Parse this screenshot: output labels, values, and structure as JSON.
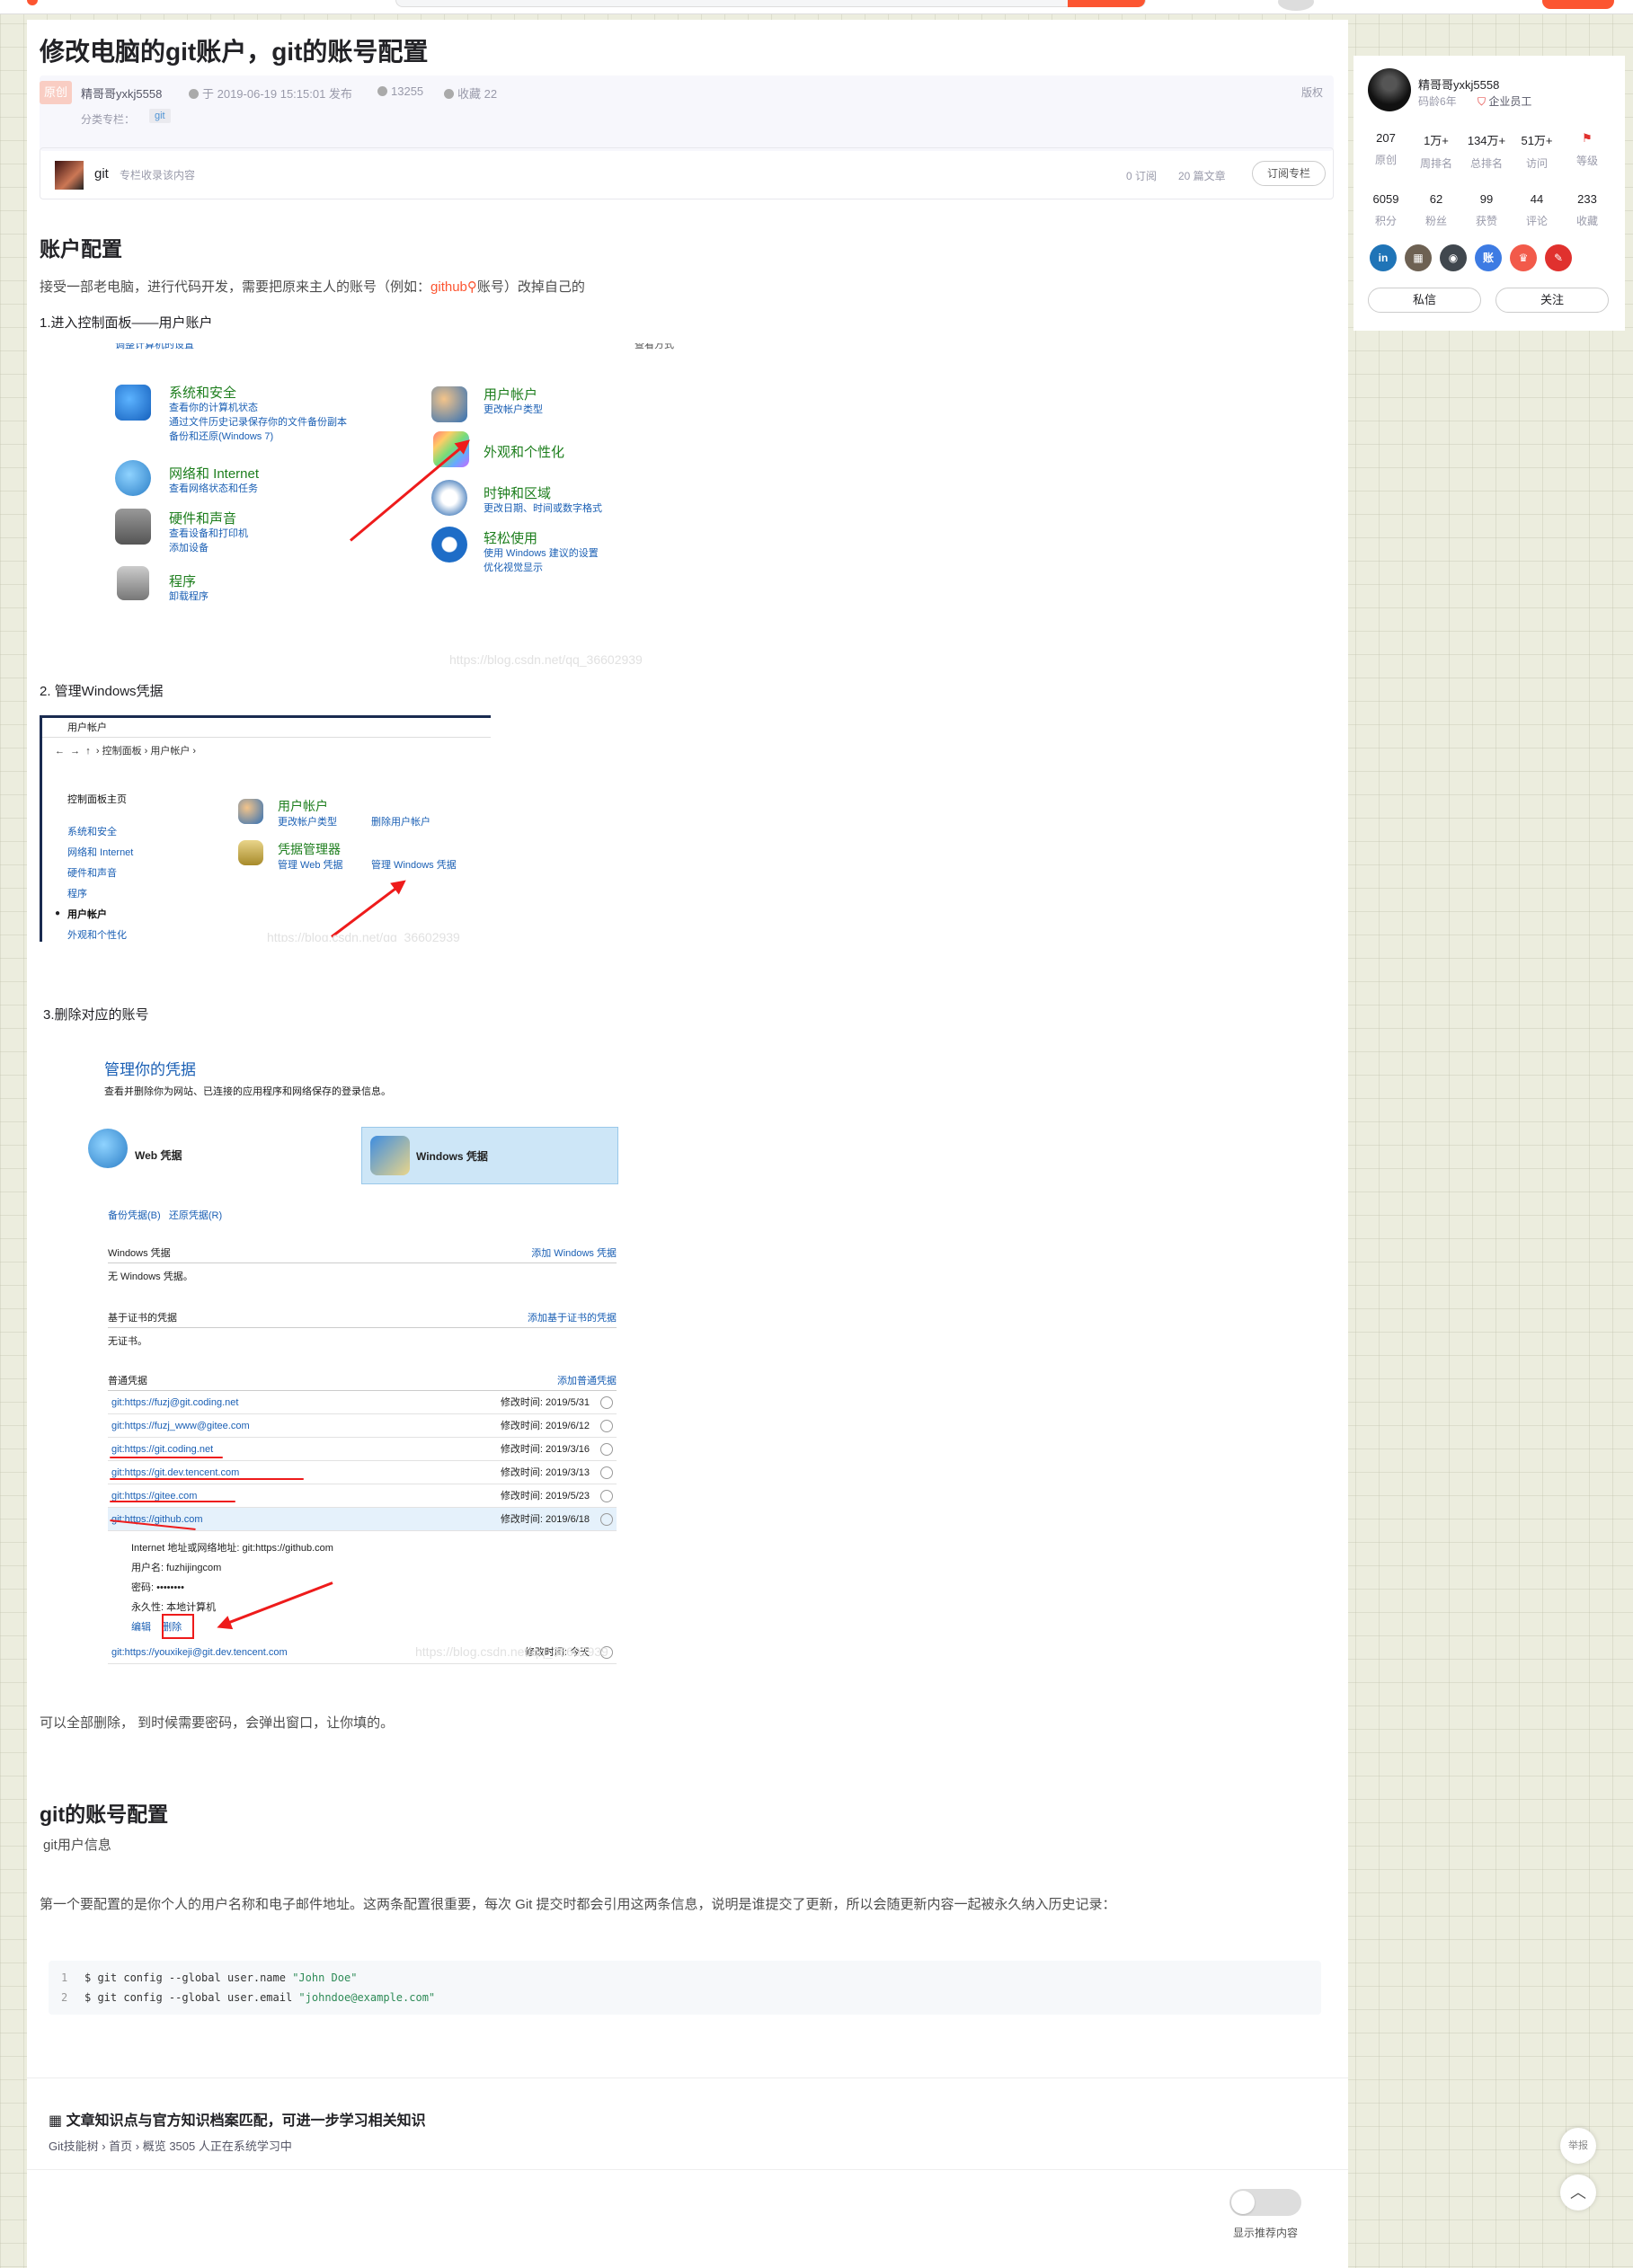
{
  "article": {
    "title": "修改电脑的git账户，git的账号配置",
    "badge": "原创",
    "author": "精哥哥yxkj5558",
    "date": "于 2019-06-19 15:15:01 发布",
    "views": "13255",
    "collect": "收藏 22",
    "copyright": "版权",
    "category_label": "分类专栏：",
    "category_tag": "git"
  },
  "column": {
    "name": "git",
    "desc": "专栏收录该内容",
    "subs": "0 订阅",
    "articles": "20 篇文章",
    "subscribe_btn": "订阅专栏"
  },
  "section1": {
    "heading": "账户配置",
    "intro_before": "接受一部老电脑，进行代码开发，需要把原来主人的账号（例如：",
    "intro_link": "github",
    "intro_after": "账号）改掉自己的",
    "step1": "1.进入控制面板——用户账户",
    "step2": "2. 管理Windows凭据",
    "step3": "3.删除对应的账号",
    "after_shots": "可以全部删除， 到时候需要密码，会弹出窗口，让你填的。"
  },
  "shot1": {
    "top_left": "调整计算机的设置",
    "top_right": "查看方式",
    "groups": [
      {
        "title": "系统和安全",
        "subs": [
          "查看你的计算机状态",
          "通过文件历史记录保存你的文件备份副本",
          "备份和还原(Windows 7)"
        ]
      },
      {
        "title": "网络和 Internet",
        "subs": [
          "查看网络状态和任务"
        ]
      },
      {
        "title": "硬件和声音",
        "subs": [
          "查看设备和打印机",
          "添加设备"
        ]
      },
      {
        "title": "程序",
        "subs": [
          "卸载程序"
        ]
      },
      {
        "title": "用户帐户",
        "subs": [
          "更改帐户类型"
        ]
      },
      {
        "title": "外观和个性化",
        "subs": []
      },
      {
        "title": "时钟和区域",
        "subs": [
          "更改日期、时间或数字格式"
        ]
      },
      {
        "title": "轻松使用",
        "subs": [
          "使用 Windows 建议的设置",
          "优化视觉显示"
        ]
      }
    ],
    "watermark": "https://blog.csdn.net/qq_36602939"
  },
  "shot2": {
    "window_title": "用户帐户",
    "breadcrumb": "›  控制面板  ›  用户帐户  ›",
    "side": [
      "控制面板主页",
      "系统和安全",
      "网络和 Internet",
      "硬件和声音",
      "程序",
      "用户帐户",
      "外观和个性化",
      "时钟和区域",
      "轻松使用"
    ],
    "ua_title": "用户帐户",
    "ua_link1": "更改帐户类型",
    "ua_link2": "删除用户帐户",
    "cred_title": "凭据管理器",
    "cred_link1": "管理 Web 凭据",
    "cred_link2": "管理 Windows 凭据",
    "watermark": "https://blog.csdn.net/qq_36602939"
  },
  "shot3": {
    "heading": "管理你的凭据",
    "desc": "查看并删除你为网站、已连接的应用程序和网络保存的登录信息。",
    "tab_web": "Web 凭据",
    "tab_win": "Windows 凭据",
    "backup": "备份凭据(B)",
    "restore": "还原凭据(R)",
    "win_section": "Windows 凭据",
    "win_add": "添加 Windows 凭据",
    "win_none": "无 Windows 凭据。",
    "cert_section": "基于证书的凭据",
    "cert_add": "添加基于证书的凭据",
    "cert_none": "无证书。",
    "generic_section": "普通凭据",
    "generic_add": "添加普通凭据",
    "rows": [
      {
        "name": "git:https://fuzj@git.coding.net",
        "time": "修改时间: 2019/5/31"
      },
      {
        "name": "git:https://fuzj_www@gitee.com",
        "time": "修改时间: 2019/6/12"
      },
      {
        "name": "git:https://git.coding.net",
        "time": "修改时间: 2019/3/16"
      },
      {
        "name": "git:https://git.dev.tencent.com",
        "time": "修改时间: 2019/3/13"
      },
      {
        "name": "git:https://gitee.com",
        "time": "修改时间: 2019/5/23"
      },
      {
        "name": "git:https://github.com",
        "time": "修改时间: 2019/6/18"
      }
    ],
    "detail": [
      "Internet 地址或网络地址:  git:https://github.com",
      "用户名:  fuzhijingcom",
      "密码:  ••••••••",
      "永久性:  本地计算机"
    ],
    "edit": "编辑",
    "delete": "删除",
    "last_row": {
      "name": "git:https://youxikeji@git.dev.tencent.com",
      "time": "修改时间: 今天"
    },
    "watermark": "https://blog.csdn.net/qq_36602939"
  },
  "section2": {
    "heading": "git的账号配置",
    "sub": "git用户信息",
    "para": "第一个要配置的是你个人的用户名称和电子邮件地址。这两条配置很重要，每次 Git 提交时都会引用这两条信息，说明是谁提交了更新，所以会随更新内容一起被永久纳入历史记录：",
    "code": [
      {
        "num": "1",
        "cmd": "$ git config --global user.name ",
        "str": "\"John Doe\""
      },
      {
        "num": "2",
        "cmd": "$ git config --global user.email ",
        "str": "\"johndoe@example.com\""
      }
    ]
  },
  "knowledge": {
    "title": "文章知识点与官方知识档案匹配，可进一步学习相关知识",
    "sub": "Git技能树 › 首页 › 概览   3505 人正在系统学习中"
  },
  "toggle_label": "显示推荐内容",
  "sidebar": {
    "name": "精哥哥yxkj5558",
    "age": "码龄6年",
    "role": "企业员工",
    "stats1": [
      {
        "v": "207",
        "k": "原创"
      },
      {
        "v": "1万+",
        "k": "周排名"
      },
      {
        "v": "134万+",
        "k": "总排名"
      },
      {
        "v": "51万+",
        "k": "访问"
      },
      {
        "v": "",
        "k": "等级"
      }
    ],
    "stats2": [
      {
        "v": "6059",
        "k": "积分"
      },
      {
        "v": "62",
        "k": "粉丝"
      },
      {
        "v": "99",
        "k": "获赞"
      },
      {
        "v": "44",
        "k": "评论"
      },
      {
        "v": "233",
        "k": "收藏"
      }
    ],
    "badges": [
      {
        "t": "in",
        "c": "#1f74b7"
      },
      {
        "t": "▦",
        "c": "#6d6153"
      },
      {
        "t": "◉",
        "c": "#40474e"
      },
      {
        "t": "账",
        "c": "#3d7be3"
      },
      {
        "t": "♛",
        "c": "#f25a4a"
      },
      {
        "t": "✎",
        "c": "#e0312e"
      }
    ],
    "msg_btn": "私信",
    "follow_btn": "关注"
  },
  "float": {
    "report": "举报",
    "top": "︿"
  },
  "colors": {
    "accent": "#fc5531",
    "link_blue": "#1a5fb4",
    "cp_green": "#1d7e1d",
    "annotation_red": "#ee1b1b"
  }
}
